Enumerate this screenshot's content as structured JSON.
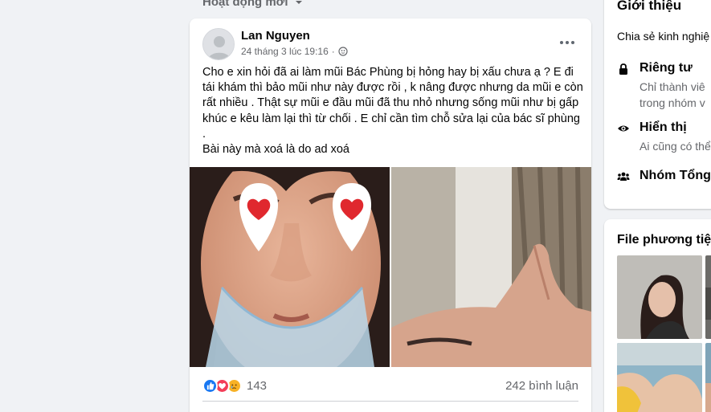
{
  "feed": {
    "filter_label": "Hoạt động mới",
    "filter_icon": "chevron-down-icon"
  },
  "post": {
    "author": "Lan Nguyen",
    "timestamp": "24 tháng 3 lúc 19:16",
    "separator": "·",
    "privacy_icon": "globe-icon",
    "more_icon": "more-options-icon",
    "body_lines": [
      "Cho e xin hỏi đã ai làm mũi Bác Phùng bị hỏng hay bị xấu chưa ạ ? E đi tái khám thì bảo mũi như này được rồi , k nâng được nhưng da mũi e còn rất nhiều . Thật sự mũi e đầu mũi đã thu nhỏ nhưng sống mũi như bị gấp khúc e kêu làm lại thì từ chối . E chỉ cần tìm chỗ sửa lại của bác sĩ phùng .",
      "Bài này mà xoá là do ad xoá"
    ],
    "reaction_icons": [
      "like-icon",
      "love-icon",
      "sad-icon"
    ],
    "reaction_count": "143",
    "comment_count": "242 bình luận",
    "colors": {
      "like": "#1877f2",
      "love": "#f33e58",
      "sad": "#f7b125"
    }
  },
  "intro": {
    "title": "Giới thiệu",
    "description": "Chia sẻ kinh nghiệ",
    "rows": [
      {
        "icon": "lock-icon",
        "title": "Riêng tư",
        "lines": [
          "Chỉ thành viê",
          "trong nhóm v"
        ]
      },
      {
        "icon": "eye-icon",
        "title": "Hiển thị",
        "lines": [
          "Ai cũng có thể"
        ]
      },
      {
        "icon": "group-icon",
        "title": "Nhóm Tổng",
        "lines": []
      }
    ]
  },
  "media": {
    "title": "File phương tiệ"
  }
}
